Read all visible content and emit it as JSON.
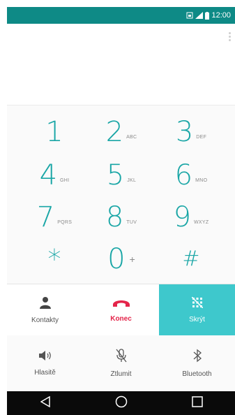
{
  "status_bar": {
    "time": "12:00",
    "icons": [
      "sim-icon",
      "signal-icon",
      "battery-icon"
    ],
    "color": "#0e8a86"
  },
  "keypad": {
    "keys": [
      {
        "digit": "1",
        "letters": ""
      },
      {
        "digit": "2",
        "letters": "ABC"
      },
      {
        "digit": "3",
        "letters": "DEF"
      },
      {
        "digit": "4",
        "letters": "GHI"
      },
      {
        "digit": "5",
        "letters": "JKL"
      },
      {
        "digit": "6",
        "letters": "MNO"
      },
      {
        "digit": "7",
        "letters": "PQRS"
      },
      {
        "digit": "8",
        "letters": "TUV"
      },
      {
        "digit": "9",
        "letters": "WXYZ"
      },
      {
        "digit": "*",
        "letters": ""
      },
      {
        "digit": "0",
        "letters": "+"
      },
      {
        "digit": "#",
        "letters": ""
      }
    ],
    "digit_color": "#1aa6a6"
  },
  "actions": {
    "contacts_label": "Kontakty",
    "end_label": "Konec",
    "hide_label": "Skrýt",
    "end_color": "#e4254a",
    "active_color": "#3ec8cc"
  },
  "secondary": {
    "speaker_label": "Hlasitě",
    "mute_label": "Ztlumit",
    "bluetooth_label": "Bluetooth"
  },
  "nav": {
    "icons": [
      "back-icon",
      "home-icon",
      "recents-icon"
    ]
  }
}
